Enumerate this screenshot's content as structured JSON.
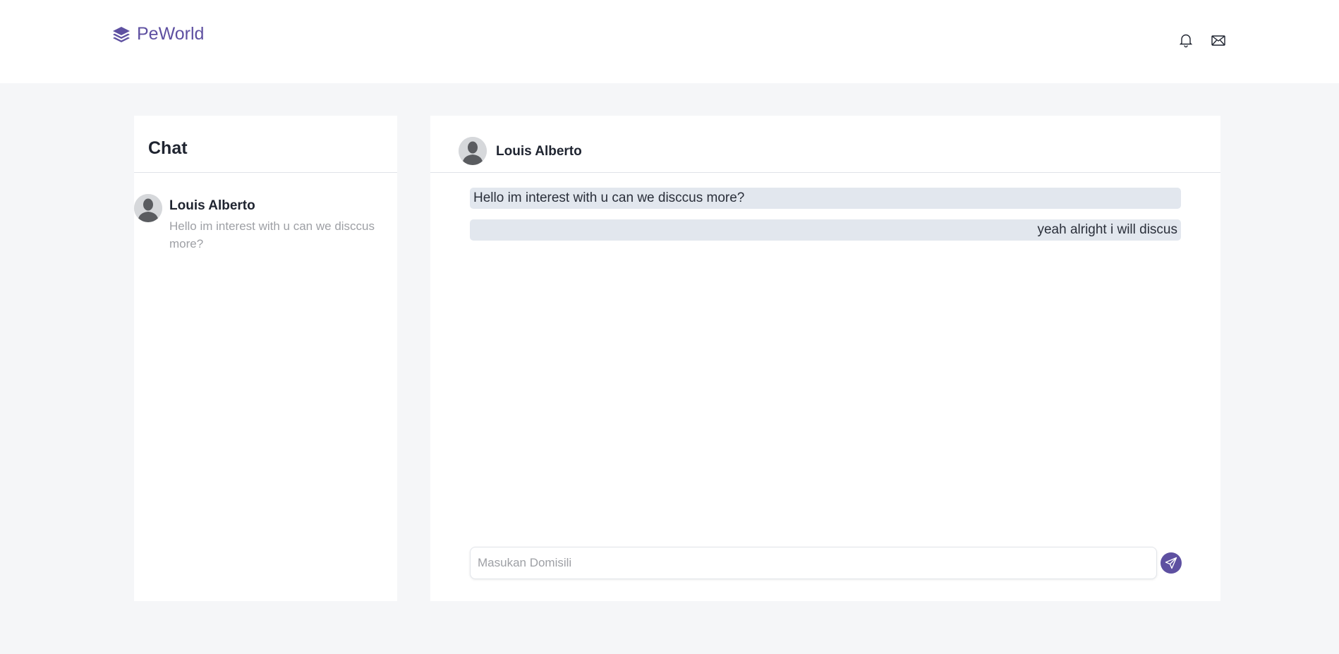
{
  "navbar": {
    "brand": "PeWorld",
    "brand_icon": "layers-icon",
    "icons": [
      "bell-icon",
      "mail-icon"
    ]
  },
  "sidebar": {
    "title": "Chat",
    "contacts": [
      {
        "name": "Louis Alberto",
        "preview": "Hello im interest with u can we disccus more?",
        "avatar_icon": "user-silhouette-icon"
      }
    ]
  },
  "conversation": {
    "contact_name": "Louis Alberto",
    "messages": [
      {
        "direction": "incoming",
        "text": "Hello im interest with u can we disccus more?"
      },
      {
        "direction": "outgoing",
        "text": "yeah alright i will discus"
      }
    ],
    "composer": {
      "placeholder": "Masukan Domisili",
      "value": ""
    },
    "send_icon": "send-icon"
  },
  "colors": {
    "brand": "#5e50a1",
    "page_background": "#f5f6f8",
    "bubble": "#e2e7ee"
  }
}
